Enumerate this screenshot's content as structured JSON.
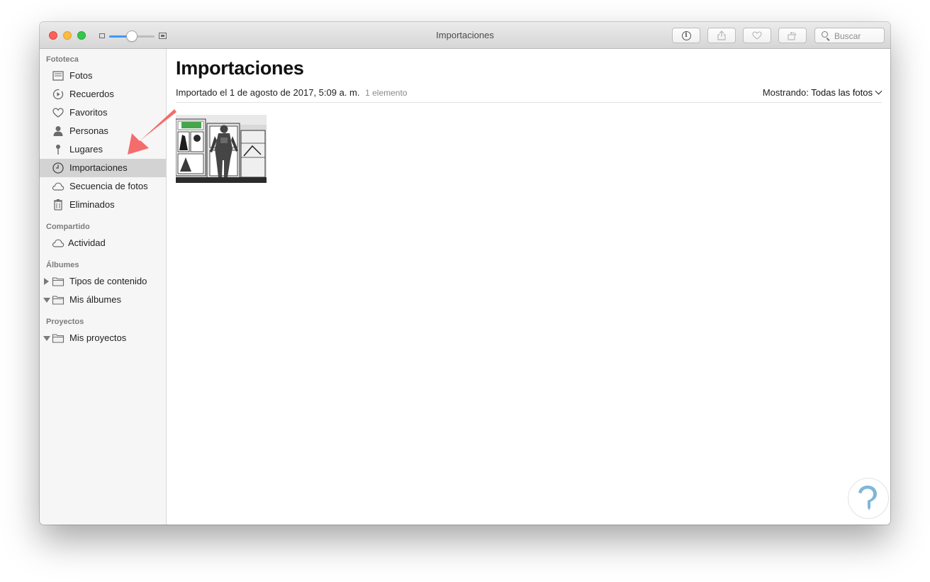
{
  "window": {
    "title": "Importaciones"
  },
  "search": {
    "placeholder": "Buscar"
  },
  "sidebar": {
    "sections": [
      {
        "header": "Fototeca",
        "items": [
          {
            "label": "Fotos",
            "icon": "photos-icon"
          },
          {
            "label": "Recuerdos",
            "icon": "memories-icon"
          },
          {
            "label": "Favoritos",
            "icon": "heart-icon"
          },
          {
            "label": "Personas",
            "icon": "person-icon"
          },
          {
            "label": "Lugares",
            "icon": "pin-icon"
          },
          {
            "label": "Importaciones",
            "icon": "clock-icon",
            "selected": true
          },
          {
            "label": "Secuencia de fotos",
            "icon": "cloud-icon"
          },
          {
            "label": "Eliminados",
            "icon": "trash-icon"
          }
        ]
      },
      {
        "header": "Compartido",
        "items": [
          {
            "label": "Actividad",
            "icon": "cloud-icon"
          }
        ]
      },
      {
        "header": "Álbumes",
        "items": [
          {
            "label": "Tipos de contenido",
            "icon": "folder-icon",
            "disclosure": "collapsed"
          },
          {
            "label": "Mis álbumes",
            "icon": "folder-icon",
            "disclosure": "expanded"
          }
        ]
      },
      {
        "header": "Proyectos",
        "items": [
          {
            "label": "Mis proyectos",
            "icon": "folder-icon",
            "disclosure": "expanded"
          }
        ]
      }
    ]
  },
  "main": {
    "title": "Importaciones",
    "import_prefix": "Importado el",
    "import_date": "1 de agosto de 2017, 5:09 a. m.",
    "import_count": "1 elemento",
    "showing_label": "Mostrando:",
    "showing_value": "Todas las fotos"
  },
  "zoom": {
    "level": 0.5
  },
  "colors": {
    "accent": "#3b99fc",
    "annotation_arrow": "#f56c6c",
    "selection": "#d3d3d3"
  }
}
